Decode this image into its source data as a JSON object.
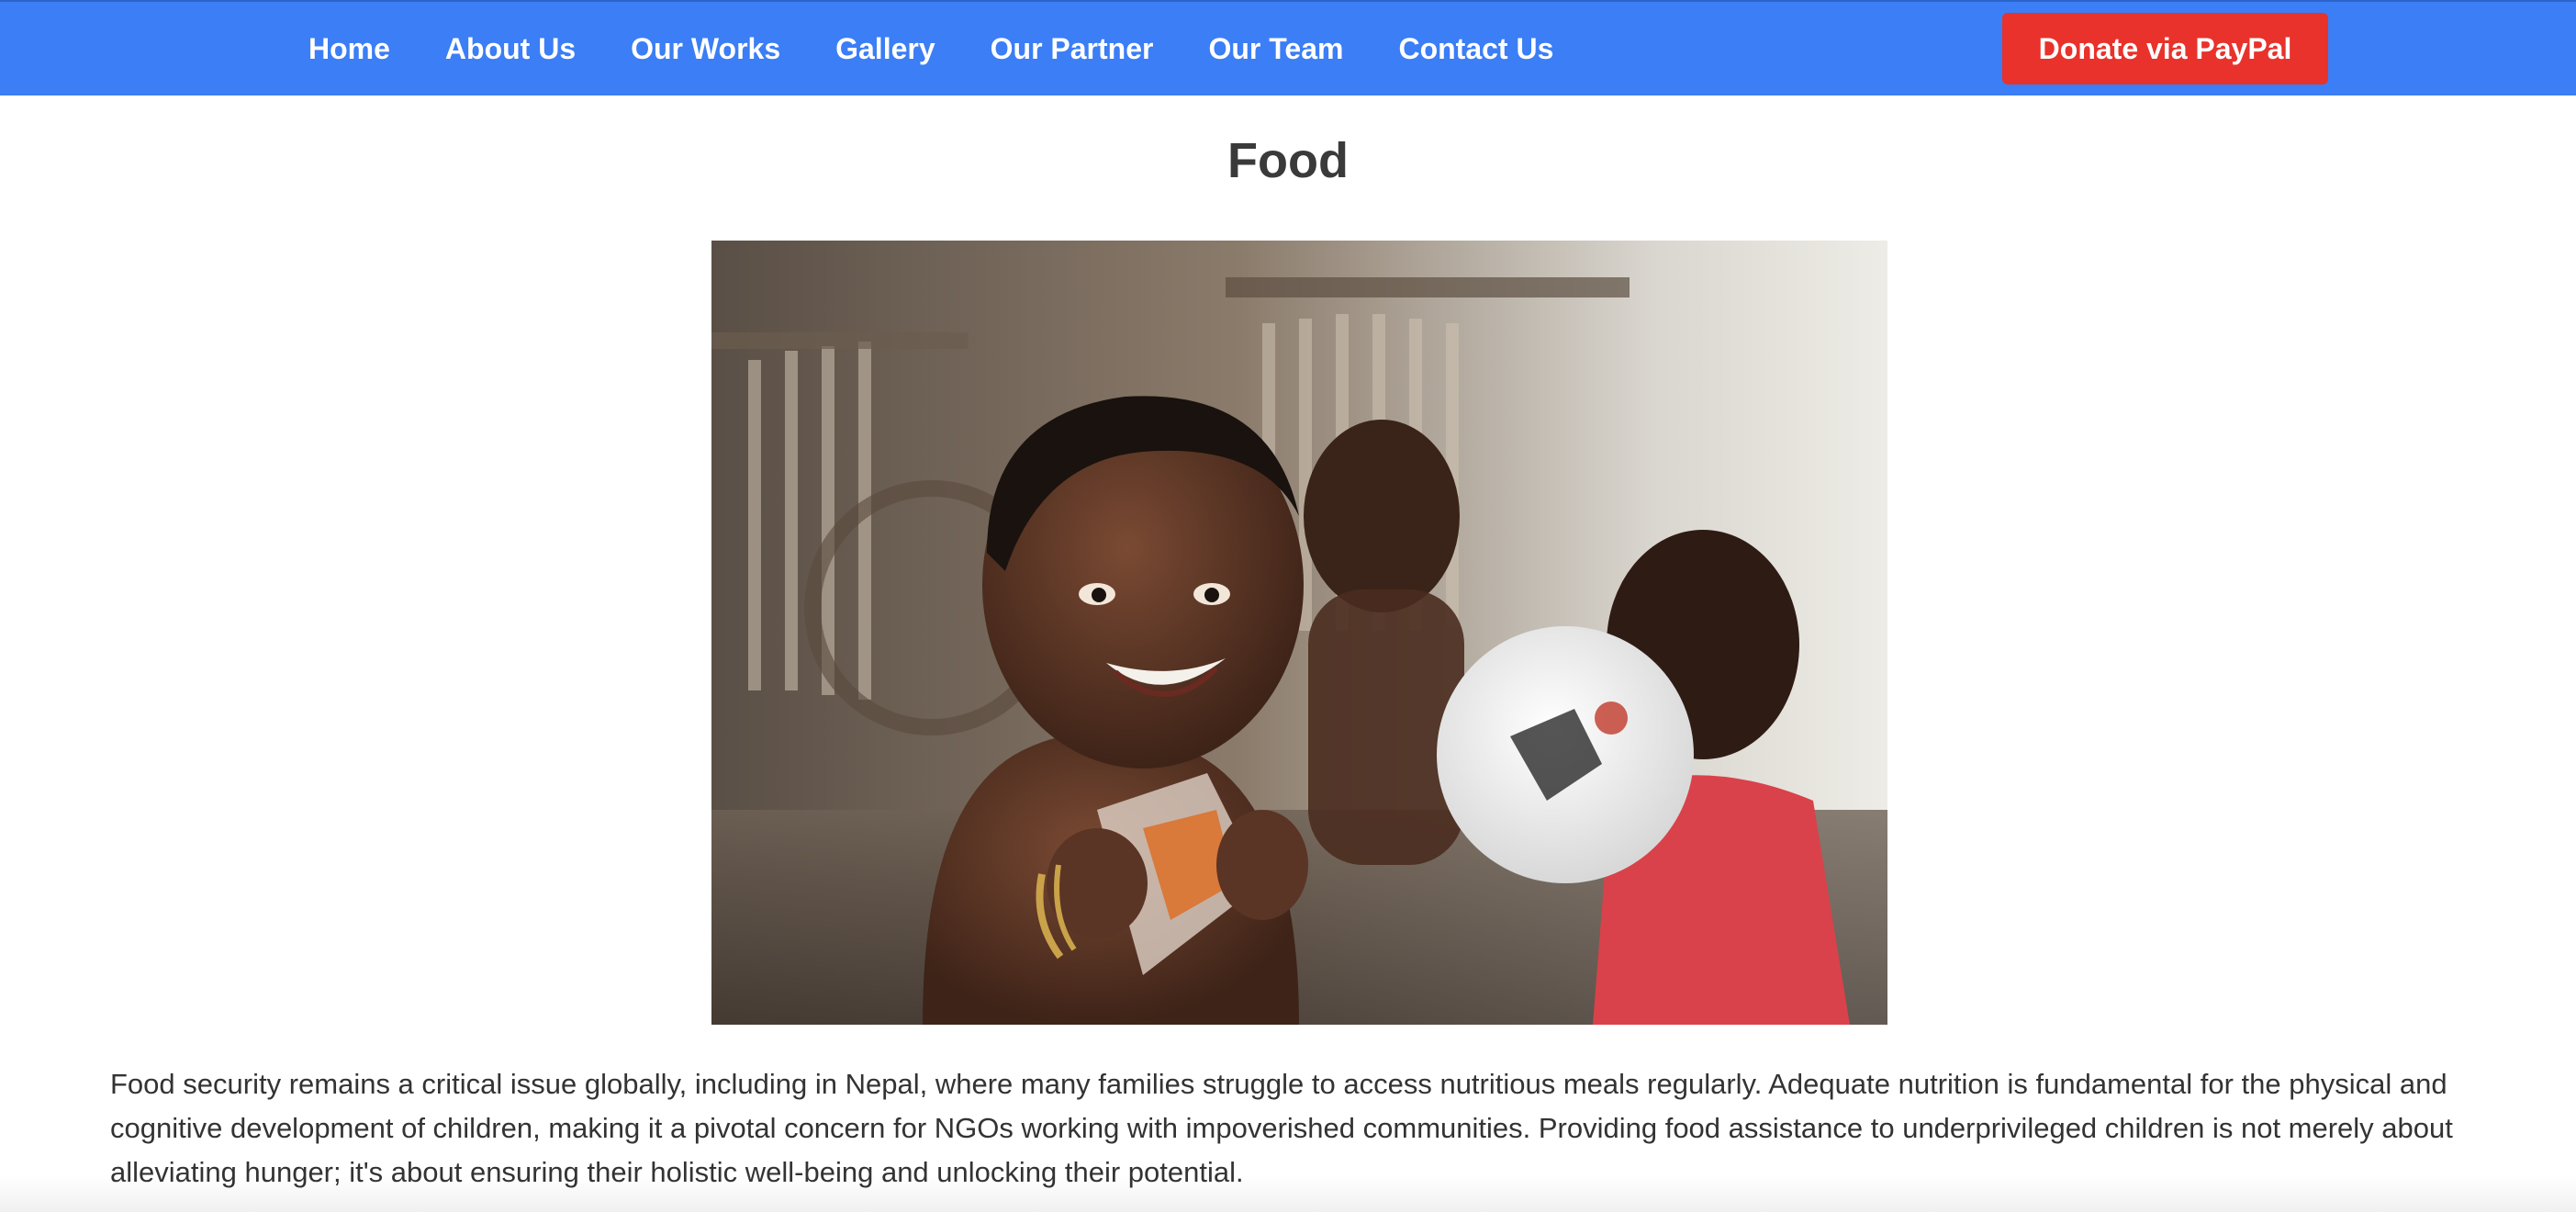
{
  "nav": {
    "items": [
      {
        "label": "Home"
      },
      {
        "label": "About Us"
      },
      {
        "label": "Our Works"
      },
      {
        "label": "Gallery"
      },
      {
        "label": "Our Partner"
      },
      {
        "label": "Our Team"
      },
      {
        "label": "Contact Us"
      }
    ],
    "donate_label": "Donate via PayPal"
  },
  "colors": {
    "header_bg": "#3b7ef5",
    "donate_bg": "#e8322b",
    "title_color": "#3a3a3a"
  },
  "main": {
    "title": "Food",
    "description": "Food security remains a critical issue globally, including in Nepal, where many families struggle to access nutritious meals regularly. Adequate nutrition is fundamental for the physical and cognitive development of children, making it a pivotal concern for NGOs working with impoverished communities. Providing food assistance to underprivileged children is not merely about alleviating hunger; it's about ensuring their holistic well-being and unlocking their potential."
  }
}
